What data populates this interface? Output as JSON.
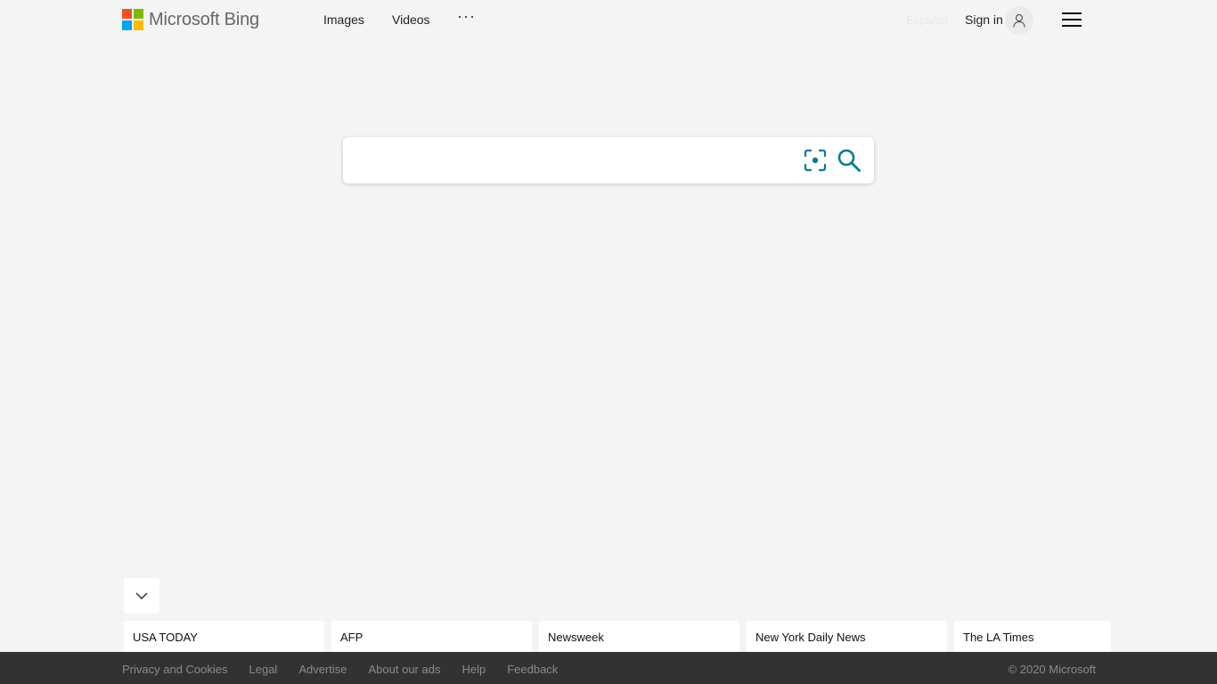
{
  "header": {
    "logo_text": "Microsoft Bing",
    "logo_colors": [
      "#f25022",
      "#7fba00",
      "#00a4ef",
      "#ffb900"
    ],
    "nav": [
      {
        "label": "Images"
      },
      {
        "label": "Videos"
      }
    ],
    "more_label": "···",
    "language_link": "Español",
    "sign_in_label": "Sign in"
  },
  "search": {
    "placeholder": "",
    "value": "",
    "accent_color": "#0f7b8e"
  },
  "news_sources": [
    {
      "label": "USA TODAY"
    },
    {
      "label": "AFP"
    },
    {
      "label": "Newsweek"
    },
    {
      "label": "New York Daily News"
    },
    {
      "label": "The LA Times"
    }
  ],
  "footer": {
    "links": [
      {
        "label": "Privacy and Cookies"
      },
      {
        "label": "Legal"
      },
      {
        "label": "Advertise"
      },
      {
        "label": "About our ads"
      },
      {
        "label": "Help"
      },
      {
        "label": "Feedback"
      }
    ],
    "copyright": "© 2020 Microsoft"
  }
}
